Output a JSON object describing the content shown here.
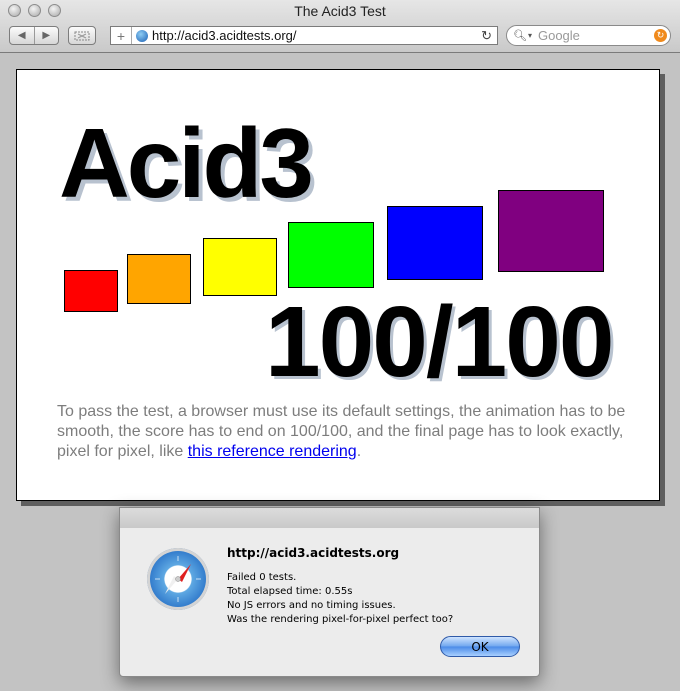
{
  "window": {
    "title": "The Acid3 Test"
  },
  "toolbar": {
    "back_glyph": "◀",
    "forward_glyph": "▶",
    "add_bookmark_glyph": "+",
    "reload_glyph": "↻",
    "url": "http://acid3.acidtests.org/",
    "search_placeholder": "Google",
    "search_icon": "magnifier-icon",
    "clear_glyph": "↻"
  },
  "page": {
    "heading": "Acid3",
    "score": "100/100",
    "description_text": "To pass the test, a browser must use its default settings, the animation has to be smooth, the score has to end on 100/100, and the final page has to look exactly, pixel for pixel, like ",
    "reference_link": "this reference rendering",
    "description_end": ".",
    "boxes": [
      "red",
      "orange",
      "yellow",
      "lime",
      "blue",
      "purple"
    ]
  },
  "colors": {
    "box_red": "#ff0000",
    "box_orange": "#ffa500",
    "box_yellow": "#ffff00",
    "box_lime": "#00ff00",
    "box_blue": "#0000ff",
    "box_purple": "#800080",
    "link": "#0000ee",
    "description": "#7d7d7d"
  },
  "dialog": {
    "icon": "safari-compass-icon",
    "title": "http://acid3.acidtests.org",
    "line1": "Failed 0 tests.",
    "line2": "Total elapsed time: 0.55s",
    "line3": "No JS errors and no timing issues.",
    "line4": "Was the rendering pixel-for-pixel perfect too?",
    "ok_label": "OK"
  }
}
